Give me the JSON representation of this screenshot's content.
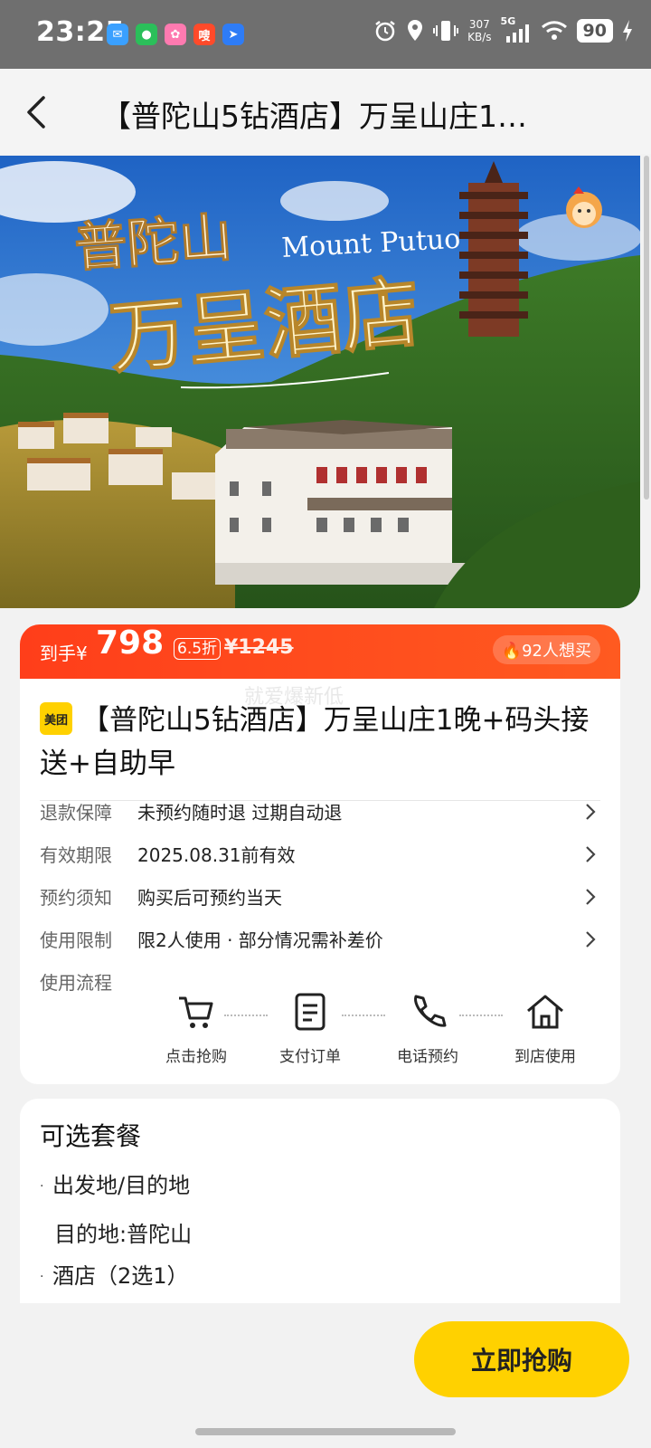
{
  "status_bar": {
    "time": "23:25",
    "net_speed_value": "307",
    "net_speed_unit": "KB/s",
    "network": "5G",
    "battery": "90",
    "app_badge": "嗖"
  },
  "nav": {
    "title": "【普陀山5钻酒店】万呈山庄1…"
  },
  "hero": {
    "headline_1": "普陀山",
    "headline_en": "Mount Putuo",
    "headline_2": "万呈酒店"
  },
  "price": {
    "label": "到手¥",
    "current": "798",
    "discount": "6.5折",
    "original": "¥1245",
    "want_count": "92人想买"
  },
  "product": {
    "watermark": "就爱爆新低",
    "brand": "美团",
    "title": "【普陀山5钻酒店】万呈山庄1晚+码头接送+自助早"
  },
  "info_rows": [
    {
      "label": "退款保障",
      "value": "未预约随时退 过期自动退"
    },
    {
      "label": "有效期限",
      "value": "2025.08.31前有效"
    },
    {
      "label": "预约须知",
      "value": "购买后可预约当天"
    },
    {
      "label": "使用限制",
      "value": "限2人使用 · 部分情况需补差价"
    }
  ],
  "process": {
    "label": "使用流程",
    "steps": [
      "点击抢购",
      "支付订单",
      "电话预约",
      "到店使用"
    ]
  },
  "packages": {
    "title": "可选套餐",
    "item_1": "出发地/目的地",
    "item_1_detail": "目的地:普陀山",
    "item_2": "酒店（2选1）"
  },
  "buy_button": "立即抢购",
  "colors": {
    "accent_red": "#ff3e1a",
    "accent_yellow": "#ffd100"
  }
}
